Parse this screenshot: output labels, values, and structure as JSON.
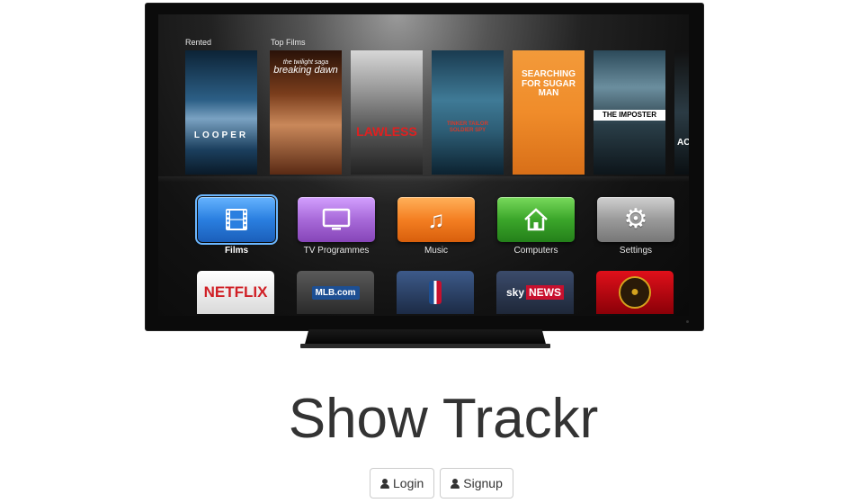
{
  "tv": {
    "shelf_labels": [
      "Rented",
      "Top Films"
    ],
    "posters": [
      {
        "title": "LOOPER"
      },
      {
        "title": "breaking dawn",
        "subtitle": "the twilight saga"
      },
      {
        "title": "LAWLESS"
      },
      {
        "title": "TINKER TAILOR SOLDIER SPY"
      },
      {
        "title": "SEARCHING FOR SUGAR MAN"
      },
      {
        "title": "THE IMPOSTER"
      },
      {
        "title": "ACK"
      }
    ],
    "menu": [
      {
        "label": "Films",
        "icon": "film-icon",
        "color": "#2a7fe0",
        "active": true
      },
      {
        "label": "TV Programmes",
        "icon": "tv-icon",
        "color": "#a86ad9"
      },
      {
        "label": "Music",
        "icon": "music-note-icon",
        "color": "#f47f22"
      },
      {
        "label": "Computers",
        "icon": "home-icon",
        "color": "#3ba62a"
      },
      {
        "label": "Settings",
        "icon": "gear-icon",
        "color": "#9a9a9a"
      }
    ],
    "apps": [
      {
        "label": "NETFLIX",
        "icon": "netflix-logo"
      },
      {
        "label": "MLB.com",
        "icon": "mlb-logo"
      },
      {
        "label": "",
        "icon": "nba-logo"
      },
      {
        "label": "sky",
        "label2": "NEWS",
        "icon": "sky-news-logo"
      },
      {
        "label": "",
        "icon": "trailers-icon"
      }
    ]
  },
  "page": {
    "title": "Show Trackr",
    "login_label": "Login",
    "signup_label": "Signup"
  }
}
